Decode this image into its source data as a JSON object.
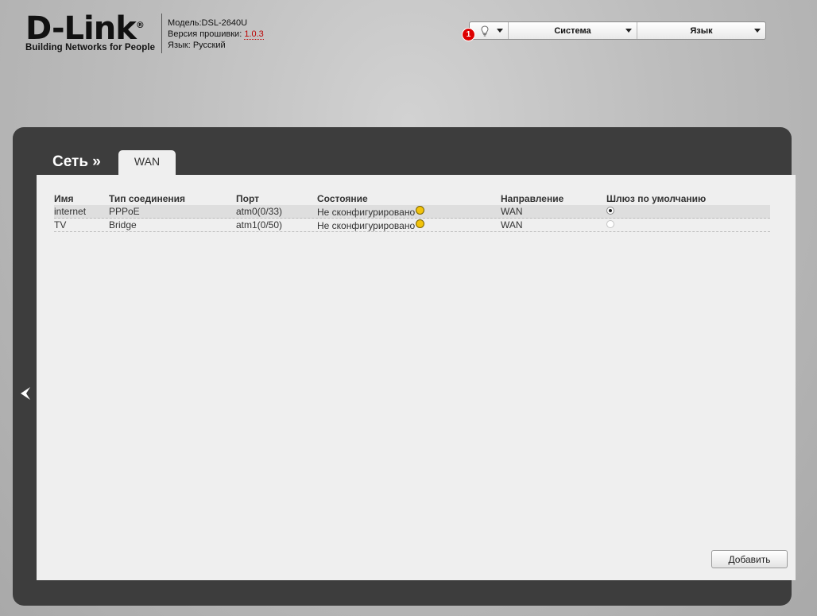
{
  "header": {
    "logo_text": "D-Link",
    "logo_tagline": "Building Networks for People",
    "model_label": "Модель:",
    "model_value": "DSL-2640U",
    "firmware_label": "Версия прошивки:",
    "firmware_value": "1.0.3",
    "language_label": "Язык:",
    "language_value": "Русский"
  },
  "toolbar": {
    "notification_count": "1",
    "system_label": "Система",
    "language_label": "Язык"
  },
  "breadcrumb": {
    "section": "Сеть »",
    "tab": "WAN"
  },
  "table": {
    "headers": [
      "Имя",
      "Тип соединения",
      "Порт",
      "Состояние",
      "Направление",
      "Шлюз по умолчанию"
    ],
    "rows": [
      {
        "name": "internet",
        "type": "PPPoE",
        "port": "atm0(0/33)",
        "state": "Не сконфигурировано",
        "direction": "WAN",
        "default_gateway": true
      },
      {
        "name": "TV",
        "type": "Bridge",
        "port": "atm1(0/50)",
        "state": "Не сконфигурировано",
        "direction": "WAN",
        "default_gateway": false
      }
    ]
  },
  "add_button_label": "Добавить",
  "colors": {
    "status_dot": "#f2c30b",
    "firmware_link": "#bb0000",
    "frame": "#3d3d3d"
  },
  "icons": {
    "notifications": "bulb-icon",
    "back": "back-arrow-icon"
  }
}
